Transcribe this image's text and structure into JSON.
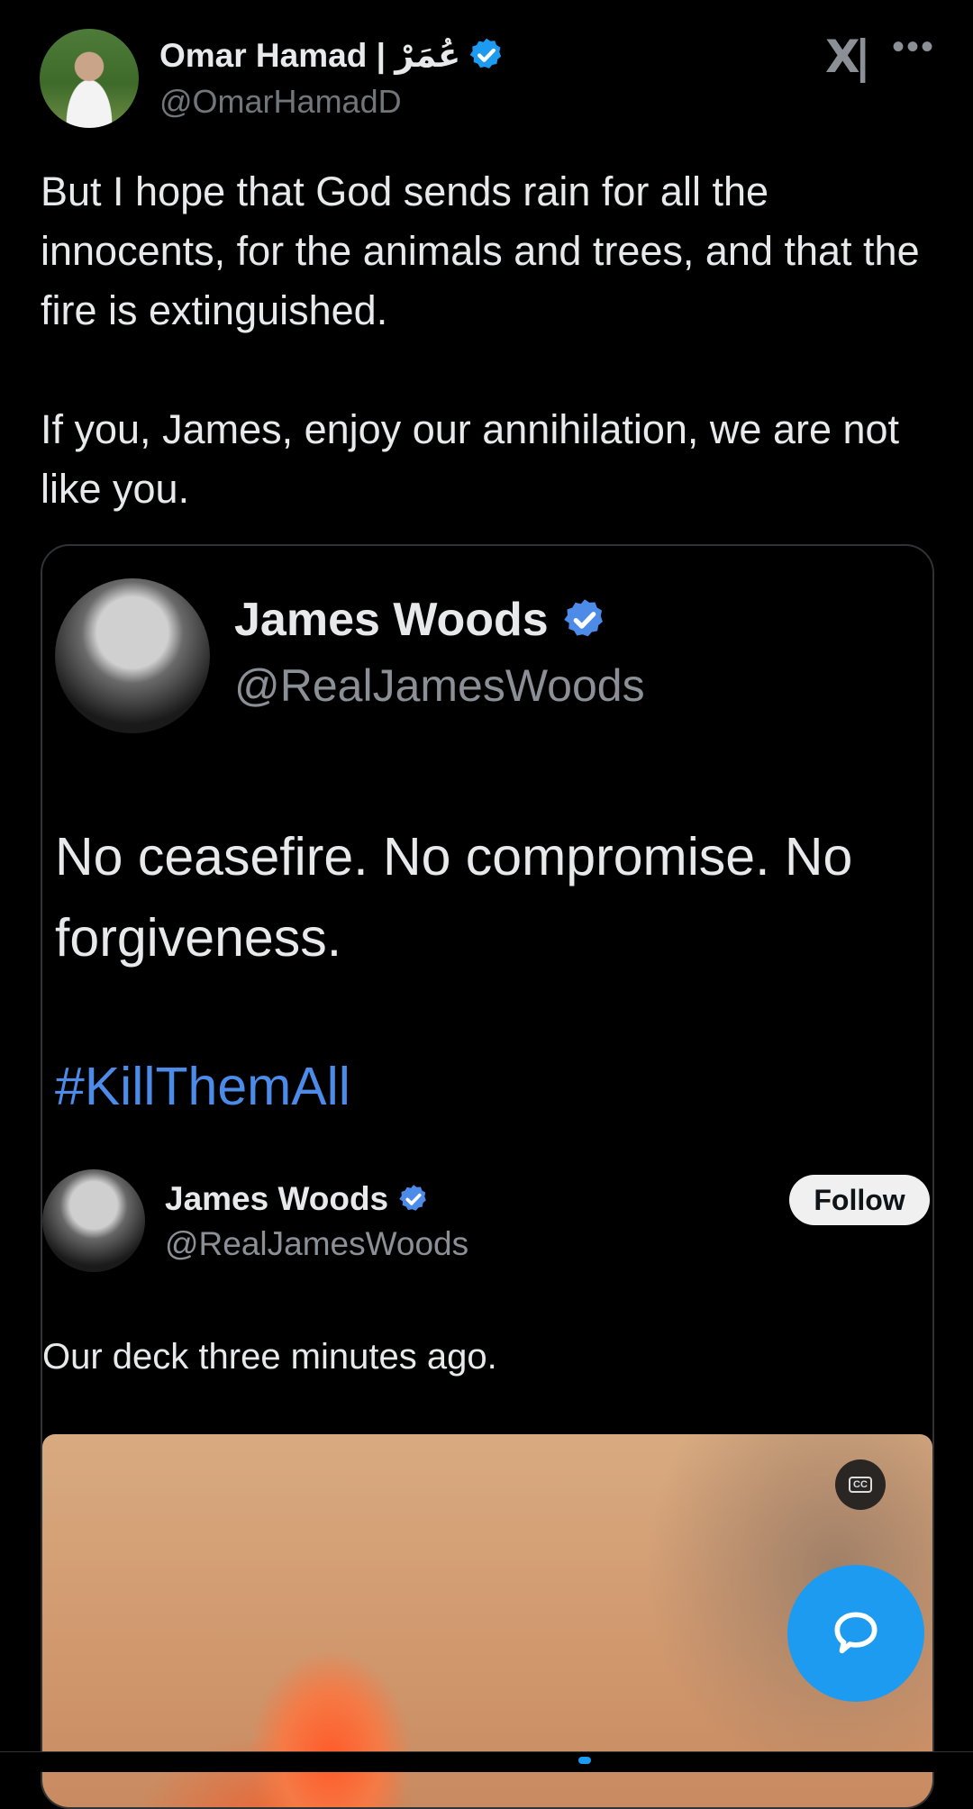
{
  "post": {
    "author_name": "Omar Hamad | عُمَرْ",
    "author_handle": "@OmarHamadD",
    "text": "But I hope that God sends rain for all the innocents, for the animals and trees, and that the fire is extinguished.\n\nIf you, James, enjoy our annihilation, we are not like you."
  },
  "quoted": {
    "author_name": "James Woods",
    "author_handle": "@RealJamesWoods",
    "text": "No ceasefire. No compromise. No forgiveness.",
    "hashtag": "#KillThemAll",
    "inner": {
      "author_name": "James Woods",
      "author_handle": "@RealJamesWoods",
      "follow_label": "Follow",
      "text": "Our deck three minutes ago."
    }
  },
  "video": {
    "cc_label": "CC"
  },
  "colors": {
    "accent": "#1d9bf0",
    "background": "#000000",
    "text": "#e7e9ea",
    "muted": "#71767b",
    "hashtag": "#4c8be8"
  },
  "icons": [
    "verified-badge-icon",
    "x-logo-icon",
    "more-icon",
    "closed-captions-icon",
    "reply-fab-icon"
  ]
}
